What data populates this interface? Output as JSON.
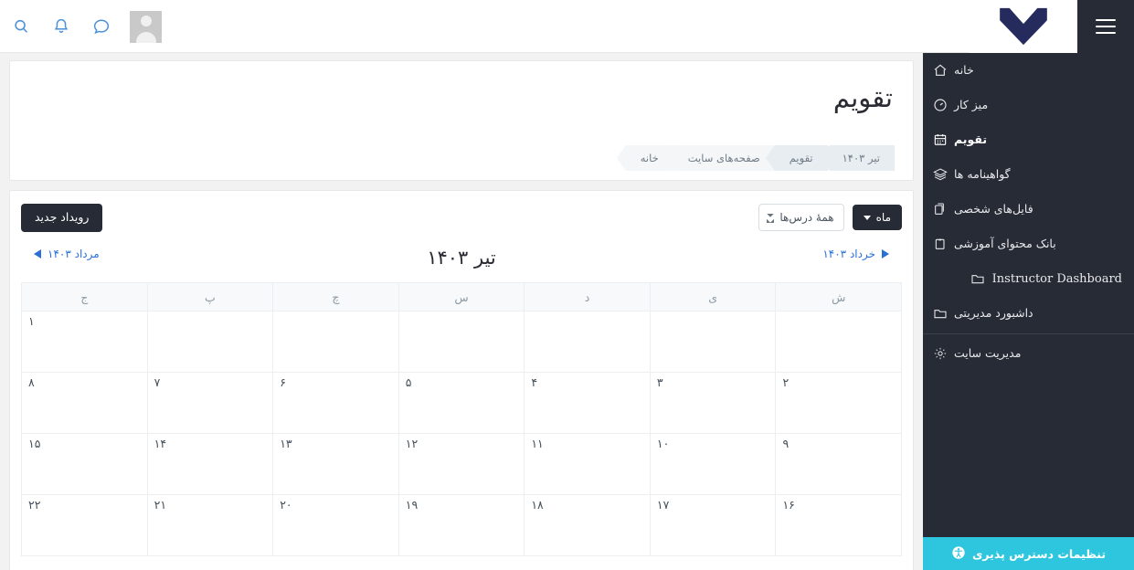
{
  "topbar": {
    "avatar_alt": "user-avatar",
    "icons": [
      {
        "name": "messages-icon",
        "label": "پیام‌ها"
      },
      {
        "name": "notifications-icon",
        "label": "اعلان‌ها"
      },
      {
        "name": "search-icon",
        "label": "جستجو"
      }
    ],
    "menu_toggle_label": "منو"
  },
  "sidebar": {
    "items": [
      {
        "label": "خانه",
        "icon": "home-icon",
        "active": false,
        "latin": false
      },
      {
        "label": "میز کار",
        "icon": "dashboard-icon",
        "active": false,
        "latin": false
      },
      {
        "label": "تقویم",
        "icon": "calendar-icon",
        "active": true,
        "latin": false
      },
      {
        "label": "گواهینامه ها",
        "icon": "certificates-icon",
        "active": false,
        "latin": false
      },
      {
        "label": "فایل‌های شخصی",
        "icon": "files-icon",
        "active": false,
        "latin": false
      },
      {
        "label": "بانک محتوای آموزشی",
        "icon": "content-bank-icon",
        "active": false,
        "latin": false
      },
      {
        "label": "Instructor Dashboard",
        "icon": "folder-icon",
        "active": false,
        "latin": true
      },
      {
        "label": "داشبورد مدیریتی",
        "icon": "folder-icon",
        "active": false,
        "latin": false
      },
      {
        "label": "مدیریت سایت",
        "icon": "gear-icon",
        "active": false,
        "latin": false
      }
    ],
    "separator_after_index": 7
  },
  "accessibility_bar": {
    "label": "تنظیمات دسترس پذیری",
    "icon": "accessibility-icon",
    "color": "#2ec6de"
  },
  "header": {
    "page_title": "تقویم",
    "breadcrumb": [
      {
        "label": "خانه"
      },
      {
        "label": "صفحه‌های سایت"
      },
      {
        "label": "تقویم"
      },
      {
        "label": "تیر ۱۴۰۳"
      }
    ]
  },
  "toolbar": {
    "new_event_label": "رویداد جدید",
    "course_filter_value": "همهٔ درس‌ها",
    "course_filter_options": [
      "همهٔ درس‌ها"
    ],
    "view_label": "ماه"
  },
  "month_nav": {
    "prev_label": "مرداد ۱۴۰۳",
    "next_label": "خرداد ۱۴۰۳",
    "current_label": "تیر ۱۴۰۳"
  },
  "calendar": {
    "weekday_headers": [
      "ش",
      "ی",
      "د",
      "س",
      "چ",
      "پ",
      "ج"
    ],
    "weeks": [
      [
        "",
        "",
        "",
        "",
        "",
        "",
        "۱"
      ],
      [
        "۲",
        "۳",
        "۴",
        "۵",
        "۶",
        "۷",
        "۸"
      ],
      [
        "۹",
        "۱۰",
        "۱۱",
        "۱۲",
        "۱۳",
        "۱۴",
        "۱۵"
      ],
      [
        "۱۶",
        "۱۷",
        "۱۸",
        "۱۹",
        "۲۰",
        "۲۱",
        "۲۲"
      ]
    ]
  },
  "colors": {
    "sidebar_bg": "#262b36",
    "accent_link": "#2a6fd6",
    "accessibility": "#2ec6de",
    "logo_navy": "#262b5e"
  }
}
